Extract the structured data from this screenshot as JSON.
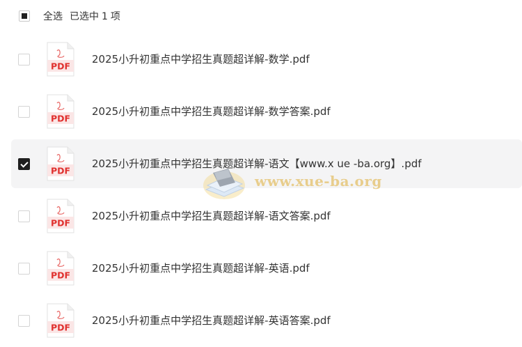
{
  "header": {
    "select_all_label": "全选",
    "selected_prefix": "已选中",
    "selected_count": "1",
    "selected_suffix": "项"
  },
  "icons": {
    "file_type_label": "PDF",
    "file_icon_color": "#e0312f"
  },
  "files": [
    {
      "name": "2025小升初重点中学招生真题超详解-数学.pdf",
      "checked": false
    },
    {
      "name": "2025小升初重点中学招生真题超详解-数学答案.pdf",
      "checked": false
    },
    {
      "name": "2025小升初重点中学招生真题超详解-语文【www.x ue -ba.org】.pdf",
      "checked": true
    },
    {
      "name": "2025小升初重点中学招生真题超详解-语文答案.pdf",
      "checked": false
    },
    {
      "name": "2025小升初重点中学招生真题超详解-英语.pdf",
      "checked": false
    },
    {
      "name": "2025小升初重点中学招生真题超详解-英语答案.pdf",
      "checked": false
    }
  ],
  "watermark": {
    "text": "www.xue-ba.org"
  }
}
